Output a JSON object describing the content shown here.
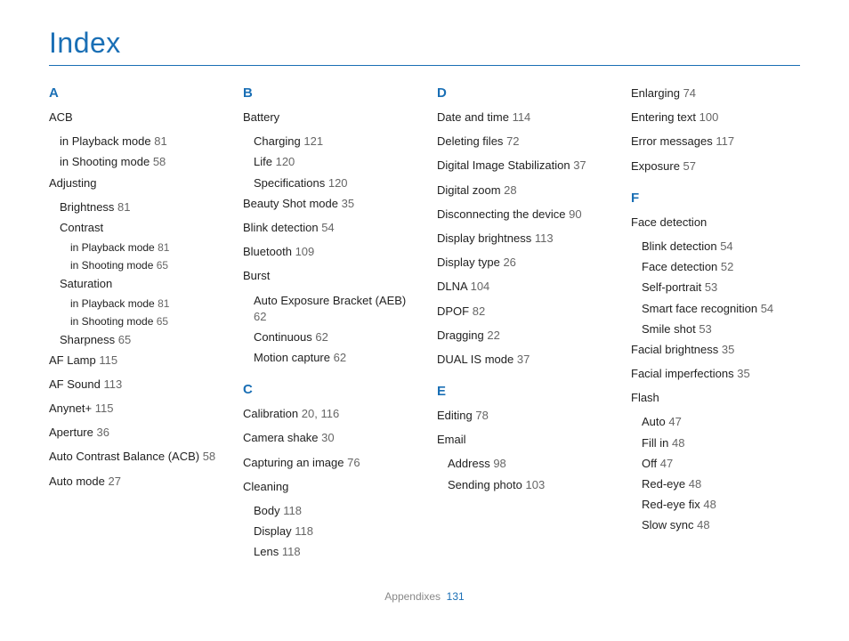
{
  "title": "Index",
  "footer": {
    "label": "Appendixes",
    "page": "131"
  },
  "columns": [
    {
      "groups": [
        {
          "letter": "A",
          "entries": [
            {
              "label": "ACB",
              "subs": [
                {
                  "label": "in Playback mode",
                  "page": "81"
                },
                {
                  "label": "in Shooting mode",
                  "page": "58"
                }
              ]
            },
            {
              "label": "Adjusting",
              "subs": [
                {
                  "label": "Brightness",
                  "page": "81"
                },
                {
                  "label": "Contrast",
                  "subs": [
                    {
                      "label": "in Playback mode",
                      "page": "81"
                    },
                    {
                      "label": "in Shooting mode",
                      "page": "65"
                    }
                  ]
                },
                {
                  "label": "Saturation",
                  "subs": [
                    {
                      "label": "in Playback mode",
                      "page": "81"
                    },
                    {
                      "label": "in Shooting mode",
                      "page": "65"
                    }
                  ]
                },
                {
                  "label": "Sharpness",
                  "page": "65"
                }
              ]
            },
            {
              "label": "AF Lamp",
              "page": "115"
            },
            {
              "label": "AF Sound",
              "page": "113"
            },
            {
              "label": "Anynet+",
              "page": "115"
            },
            {
              "label": "Aperture",
              "page": "36"
            },
            {
              "label": "Auto Contrast Balance (ACB)",
              "page": "58"
            },
            {
              "label": "Auto mode",
              "page": "27"
            }
          ]
        }
      ]
    },
    {
      "groups": [
        {
          "letter": "B",
          "entries": [
            {
              "label": "Battery",
              "subs": [
                {
                  "label": "Charging",
                  "page": "121"
                },
                {
                  "label": "Life",
                  "page": "120"
                },
                {
                  "label": "Specifications",
                  "page": "120"
                }
              ]
            },
            {
              "label": "Beauty Shot mode",
              "page": "35"
            },
            {
              "label": "Blink detection",
              "page": "54"
            },
            {
              "label": "Bluetooth",
              "page": "109"
            },
            {
              "label": "Burst",
              "subs": [
                {
                  "label": "Auto Exposure Bracket (AEB)",
                  "page": "62"
                },
                {
                  "label": "Continuous",
                  "page": "62"
                },
                {
                  "label": "Motion capture",
                  "page": "62"
                }
              ]
            }
          ]
        },
        {
          "letter": "C",
          "entries": [
            {
              "label": "Calibration",
              "page": "20, 116"
            },
            {
              "label": "Camera shake",
              "page": "30"
            },
            {
              "label": "Capturing an image",
              "page": "76"
            },
            {
              "label": "Cleaning",
              "subs": [
                {
                  "label": "Body",
                  "page": "118"
                },
                {
                  "label": "Display",
                  "page": "118"
                },
                {
                  "label": "Lens",
                  "page": "118"
                }
              ]
            }
          ]
        }
      ]
    },
    {
      "groups": [
        {
          "letter": "D",
          "entries": [
            {
              "label": "Date and time",
              "page": "114"
            },
            {
              "label": "Deleting files",
              "page": "72"
            },
            {
              "label": "Digital Image Stabilization",
              "page": "37"
            },
            {
              "label": "Digital zoom",
              "page": "28"
            },
            {
              "label": "Disconnecting the device",
              "page": "90"
            },
            {
              "label": "Display brightness",
              "page": "113"
            },
            {
              "label": "Display type",
              "page": "26"
            },
            {
              "label": "DLNA",
              "page": "104"
            },
            {
              "label": "DPOF",
              "page": "82"
            },
            {
              "label": "Dragging",
              "page": "22"
            },
            {
              "label": "DUAL IS mode",
              "page": "37"
            }
          ]
        },
        {
          "letter": "E",
          "entries": [
            {
              "label": "Editing",
              "page": "78"
            },
            {
              "label": "Email",
              "subs": [
                {
                  "label": "Address",
                  "page": "98"
                },
                {
                  "label": "Sending photo",
                  "page": "103"
                }
              ]
            }
          ]
        }
      ]
    },
    {
      "groups": [
        {
          "letter": "",
          "entries": [
            {
              "label": "Enlarging",
              "page": "74"
            },
            {
              "label": "Entering text",
              "page": "100"
            },
            {
              "label": "Error messages",
              "page": "117"
            },
            {
              "label": "Exposure",
              "page": "57"
            }
          ]
        },
        {
          "letter": "F",
          "entries": [
            {
              "label": "Face detection",
              "subs": [
                {
                  "label": "Blink detection",
                  "page": "54"
                },
                {
                  "label": "Face detection",
                  "page": "52"
                },
                {
                  "label": "Self-portrait",
                  "page": "53"
                },
                {
                  "label": "Smart face recognition",
                  "page": "54"
                },
                {
                  "label": "Smile shot",
                  "page": "53"
                }
              ]
            },
            {
              "label": "Facial brightness",
              "page": "35"
            },
            {
              "label": "Facial imperfections",
              "page": "35"
            },
            {
              "label": "Flash",
              "subs": [
                {
                  "label": "Auto",
                  "page": "47"
                },
                {
                  "label": "Fill in",
                  "page": "48"
                },
                {
                  "label": "Off",
                  "page": "47"
                },
                {
                  "label": "Red-eye",
                  "page": "48"
                },
                {
                  "label": "Red-eye fix",
                  "page": "48"
                },
                {
                  "label": "Slow sync",
                  "page": "48"
                }
              ]
            }
          ]
        }
      ]
    }
  ]
}
